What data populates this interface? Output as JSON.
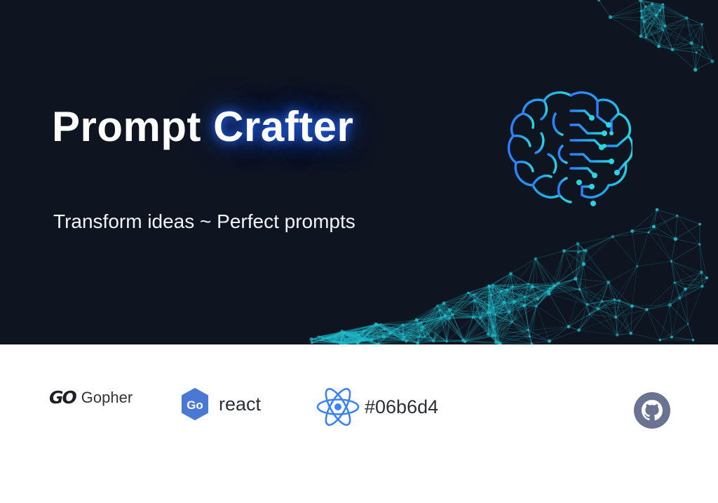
{
  "hero": {
    "title_main": "Prompt",
    "title_accent": "Crafter",
    "subtitle": "Transform ideas ~ Perfect prompts",
    "illustration_icon": "brain-circuit-icon",
    "background_pattern": "network-mesh"
  },
  "badges": [
    {
      "icon": "gopher-logo-icon",
      "logo_text": "GO",
      "label": "Gopher"
    },
    {
      "icon": "go-hexagon-icon",
      "logo_text": "Go",
      "label": "react",
      "color": "#4a78d6"
    },
    {
      "icon": "react-atom-icon",
      "label": "#06b6d4",
      "color": "#3b82f6"
    }
  ],
  "github": {
    "icon": "github-icon",
    "color": "#6b7392"
  },
  "colors": {
    "hero_background": "#0e1420",
    "accent_glow": "#1f5cff",
    "network": "#22b8c8",
    "footer_background": "#ffffff"
  }
}
